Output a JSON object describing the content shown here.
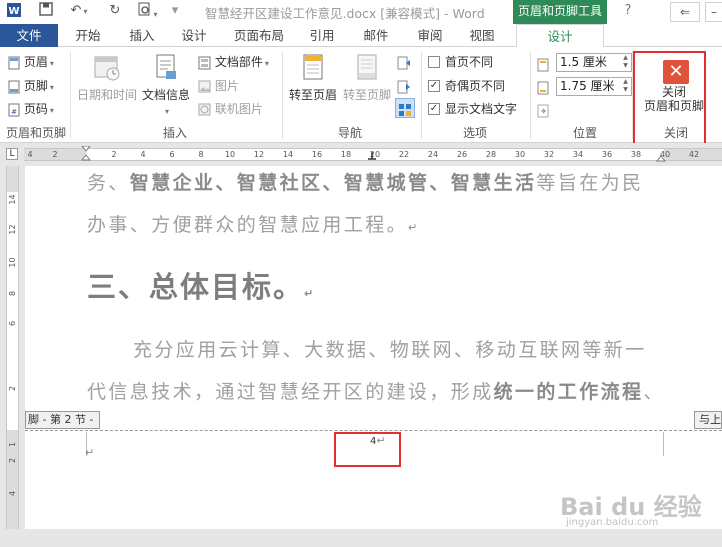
{
  "app": {
    "doc_title": "智慧经开区建设工作意见.docx [兼容模式] - Word",
    "context_tab_group": "页眉和页脚工具"
  },
  "tabs": {
    "file": "文件",
    "items": [
      "开始",
      "插入",
      "设计",
      "页面布局",
      "引用",
      "邮件",
      "审阅",
      "视图"
    ],
    "active": "设计"
  },
  "ribbon": {
    "hf_group": {
      "header": "页眉",
      "footer": "页脚",
      "page_number": "页码",
      "label": "页眉和页脚"
    },
    "insert_group": {
      "date_time": "日期和时间",
      "doc_info": "文档信息",
      "doc_parts": "文档部件",
      "picture": "图片",
      "online_picture": "联机图片",
      "label": "插入"
    },
    "nav_group": {
      "goto_header": "转至页眉",
      "goto_footer": "转至页脚",
      "label": "导航"
    },
    "options_group": {
      "first_page_diff": "首页不同",
      "odd_even_diff": "奇偶页不同",
      "show_doc_text": "显示文档文字",
      "label": "选项"
    },
    "position_group": {
      "header_pos": "1.5 厘米",
      "footer_pos": "1.75 厘米",
      "label": "位置"
    },
    "close_group": {
      "close_line1": "关闭",
      "close_line2": "页眉和页脚",
      "label": "关闭"
    }
  },
  "ruler": {
    "corner": "L",
    "ticks": [
      "4",
      "2",
      "",
      "2",
      "4",
      "6",
      "8",
      "10",
      "12",
      "14",
      "16",
      "18",
      "20",
      "22",
      "24",
      "26",
      "28",
      "30",
      "32",
      "34",
      "36",
      "38",
      "40",
      "42"
    ],
    "vticks": [
      "14",
      "12",
      "10",
      "8",
      "6",
      "2",
      "1",
      "2",
      "4"
    ]
  },
  "document": {
    "line1_a": "务、",
    "line1_b": "智慧企业、智慧社区、智慧城管、智慧生活",
    "line1_c": "等旨在为民",
    "line2": "办事、方便群众的智慧应用工程。",
    "heading": "三、总体目标。",
    "line3": "充分应用云计算、大数据、物联网、移动互联网等新一",
    "line4_a": "代信息技术，通过智慧经开区的建设，形成",
    "line4_b": "统一的工作流程",
    "line4_c": "、",
    "pilcrow": "↵"
  },
  "footer": {
    "tag_left": "脚 - 第 2 节 -",
    "tag_right": "与上",
    "page_number": "4"
  },
  "watermark": {
    "main": "Bai du 经验",
    "sub": "jingyan.baidu.com"
  }
}
